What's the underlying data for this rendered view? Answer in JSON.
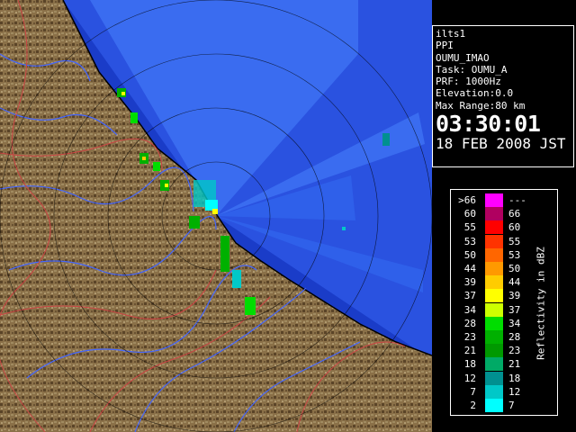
{
  "info": {
    "site": "ilts1",
    "scan_type": "PPI",
    "radar_id": "OUMU_IMAO",
    "task": "Task: OUMU_A",
    "prf": "PRF: 1000Hz",
    "elevation": "Elevation:0.0",
    "max_range": "Max Range:80 km",
    "time": "03:30:01",
    "date": "18 FEB 2008 JST"
  },
  "legend": {
    "title": "Reflectivity in dBZ",
    "rows": [
      {
        "lo": ">66",
        "hi": "---",
        "color": "#ff00ff"
      },
      {
        "lo": "60",
        "hi": "66",
        "color": "#b00060"
      },
      {
        "lo": "55",
        "hi": "60",
        "color": "#ff0000"
      },
      {
        "lo": "53",
        "hi": "55",
        "color": "#ff3300"
      },
      {
        "lo": "50",
        "hi": "53",
        "color": "#ff6600"
      },
      {
        "lo": "44",
        "hi": "50",
        "color": "#ff9900"
      },
      {
        "lo": "39",
        "hi": "44",
        "color": "#ffcc00"
      },
      {
        "lo": "37",
        "hi": "39",
        "color": "#ffff00"
      },
      {
        "lo": "34",
        "hi": "37",
        "color": "#ccff00"
      },
      {
        "lo": "28",
        "hi": "34",
        "color": "#00dd00"
      },
      {
        "lo": "23",
        "hi": "28",
        "color": "#00b000"
      },
      {
        "lo": "21",
        "hi": "23",
        "color": "#009900"
      },
      {
        "lo": "18",
        "hi": "21",
        "color": "#00aa66"
      },
      {
        "lo": "12",
        "hi": "18",
        "color": "#009090"
      },
      {
        "lo": "7",
        "hi": "12",
        "color": "#00c8c8"
      },
      {
        "lo": "2",
        "hi": "7",
        "color": "#00ffff"
      }
    ]
  },
  "colors": {
    "sea": "#1a3cc8",
    "coverage": "#3a6cf0",
    "land": "#8a7048",
    "river": "#4466ff",
    "boundary": "#cc4444"
  }
}
